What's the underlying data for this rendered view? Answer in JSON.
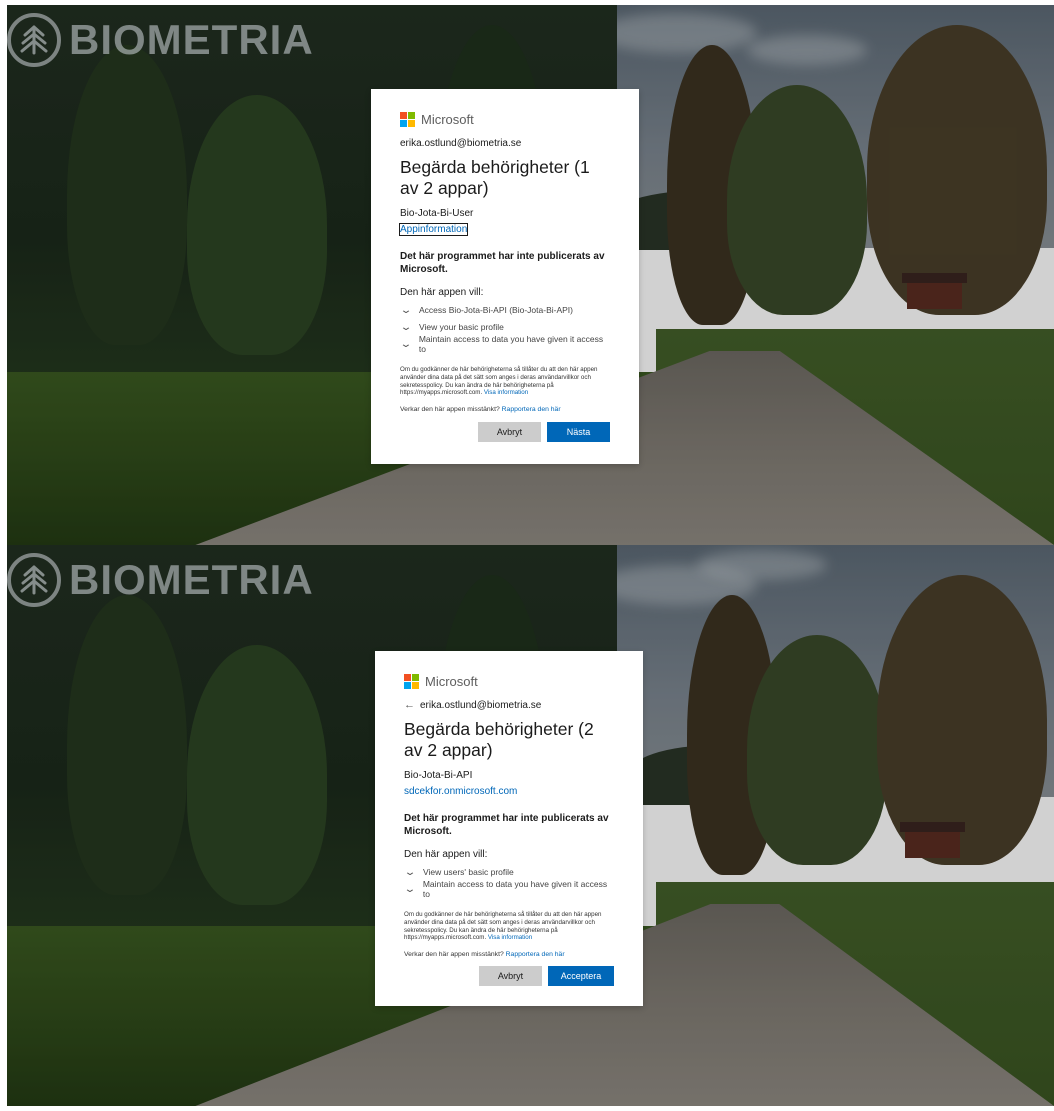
{
  "brand": {
    "logo_text": "BIOMETRIA"
  },
  "dialogs": [
    {
      "provider": "Microsoft",
      "account": "erika.ostlund@biometria.se",
      "title": "Begärda behörigheter (1 av 2 appar)",
      "app_name": "Bio-Jota-Bi-User",
      "app_link": "Appinformation",
      "warning": "Det här programmet har inte publicerats av Microsoft.",
      "wants_label": "Den här appen vill:",
      "permissions": [
        "Access Bio-Jota-Bi-API (Bio-Jota-Bi-API)",
        "View your basic profile",
        "Maintain access to data you have given it access to"
      ],
      "info_text": "Om du godkänner de här behörigheterna så tillåter du att den här appen använder dina data på det sätt som anges i deras användarvillkor och sekretesspolicy. Du kan ändra de här behörigheterna på https://myapps.microsoft.com. ",
      "info_link": "Visa information",
      "suspect_text": "Verkar den här appen misstänkt? ",
      "suspect_link": "Rapportera den här",
      "cancel_label": "Avbryt",
      "primary_label": "Nästa"
    },
    {
      "provider": "Microsoft",
      "account": "erika.ostlund@biometria.se",
      "back_icon": "arrow-left-icon",
      "title": "Begärda behörigheter (2 av 2 appar)",
      "app_name": "Bio-Jota-Bi-API",
      "app_link": "sdcekfor.onmicrosoft.com",
      "warning": "Det här programmet har inte publicerats av Microsoft.",
      "wants_label": "Den här appen vill:",
      "permissions": [
        "View users' basic profile",
        "Maintain access to data you have given it access to"
      ],
      "info_text": "Om du godkänner de här behörigheterna så tillåter du att den här appen använder dina data på det sätt som anges i deras användarvillkor och sekretesspolicy. Du kan ändra de här behörigheterna på https://myapps.microsoft.com. ",
      "info_link": "Visa information",
      "suspect_text": "Verkar den här appen misstänkt? ",
      "suspect_link": "Rapportera den här",
      "cancel_label": "Avbryt",
      "primary_label": "Acceptera"
    }
  ],
  "colors": {
    "ms_red": "#f25022",
    "ms_green": "#7fba00",
    "ms_blue": "#00a4ef",
    "ms_yellow": "#ffb900",
    "primary_button": "#0067b8",
    "secondary_button": "#cccccc",
    "link": "#0067b8"
  }
}
